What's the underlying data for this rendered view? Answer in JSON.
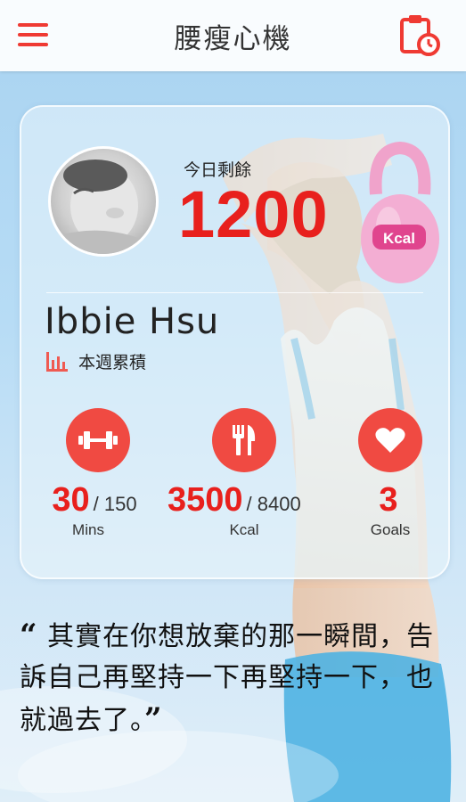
{
  "header": {
    "title": "腰瘦心機",
    "menu_icon": "hamburger-menu-icon",
    "timer_icon": "clipboard-stopwatch-icon"
  },
  "profile": {
    "remain_label": "今日剩餘",
    "remain_value": "1200",
    "kettlebell_label": "Kcal",
    "user_name": "Ibbie Hsu",
    "weekly_label": "本週累積"
  },
  "stats": [
    {
      "icon": "dumbbell-icon",
      "value": "30",
      "goal": "/ 150",
      "caption": "Mins"
    },
    {
      "icon": "fork-knife-icon",
      "value": "3500",
      "goal": "/ 8400",
      "caption": "Kcal"
    },
    {
      "icon": "heart-icon",
      "value": "3",
      "goal": "",
      "caption": "Goals"
    }
  ],
  "quote": {
    "open_mark": "“",
    "text": "其實在你想放棄的那一瞬間，告訴自己再堅持一下再堅持一下，也就過去了。",
    "close_mark": "”"
  },
  "colors": {
    "accent": "#e8201d",
    "button": "#f04a42",
    "kettlebell": "#f2a9cf"
  }
}
